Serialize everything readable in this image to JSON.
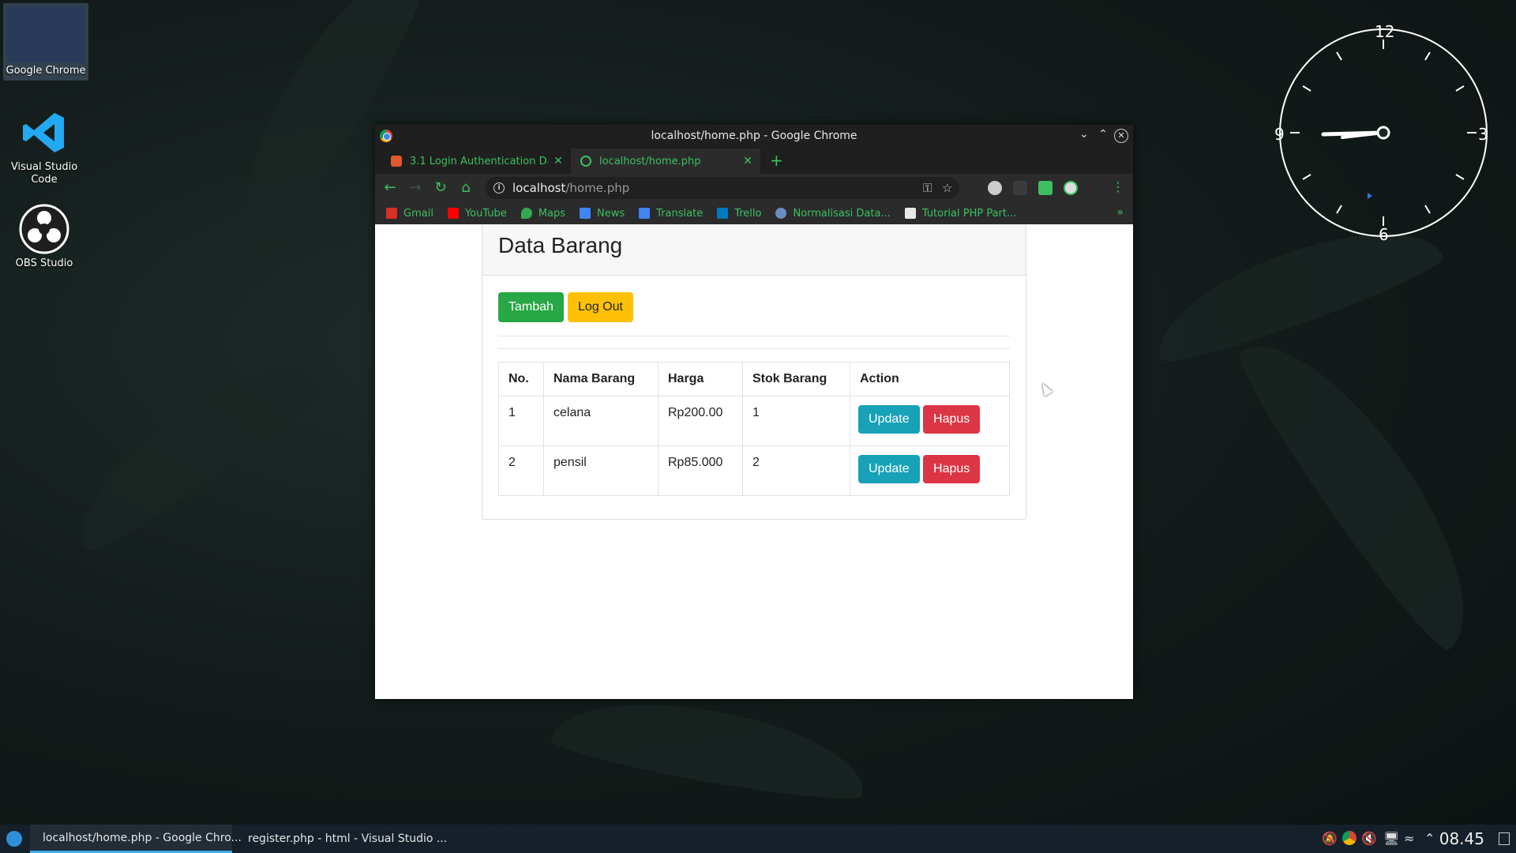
{
  "desktop": {
    "icons": [
      {
        "label": "Google Chrome"
      },
      {
        "label": "Visual Studio Code"
      },
      {
        "label": "OBS Studio"
      }
    ],
    "clock": {
      "numbers": [
        "12",
        "3",
        "6",
        "9"
      ]
    }
  },
  "window": {
    "title": "localhost/home.php - Google Chrome",
    "tabs": [
      {
        "label": "3.1 Login Authentication Data",
        "active": false
      },
      {
        "label": "localhost/home.php",
        "active": true
      }
    ],
    "address": {
      "host": "localhost",
      "path": "/home.php"
    },
    "bookmarks": [
      {
        "label": "Gmail",
        "color": "#d93025"
      },
      {
        "label": "YouTube",
        "color": "#ff0000"
      },
      {
        "label": "Maps",
        "color": "#34a853"
      },
      {
        "label": "News",
        "color": "#4285f4"
      },
      {
        "label": "Translate",
        "color": "#4285f4"
      },
      {
        "label": "Trello",
        "color": "#0079bf"
      },
      {
        "label": "Normalisasi Data...",
        "color": "#6c8ebf"
      },
      {
        "label": "Tutorial PHP Part...",
        "color": "#e8e8e8"
      }
    ],
    "more_bookmarks": "»"
  },
  "page": {
    "heading": "Data Barang",
    "buttons": {
      "add": "Tambah",
      "logout": "Log Out"
    },
    "table": {
      "headers": [
        "No.",
        "Nama Barang",
        "Harga",
        "Stok Barang",
        "Action"
      ],
      "rows": [
        {
          "no": "1",
          "nama": "celana",
          "harga": "Rp200.00",
          "stok": "1",
          "update": "Update",
          "hapus": "Hapus"
        },
        {
          "no": "2",
          "nama": "pensil",
          "harga": "Rp85.000",
          "stok": "2",
          "update": "Update",
          "hapus": "Hapus"
        }
      ]
    }
  },
  "taskbar": {
    "tasks": [
      {
        "label": "localhost/home.php - Google Chro...",
        "active": true
      },
      {
        "label": "register.php - html - Visual Studio ...",
        "active": false
      }
    ],
    "time": "08.45"
  },
  "colors": {
    "accent_green": "#3cc060",
    "success": "#28a745",
    "warning": "#ffc107",
    "info": "#17a2b8",
    "danger": "#dc3545"
  }
}
